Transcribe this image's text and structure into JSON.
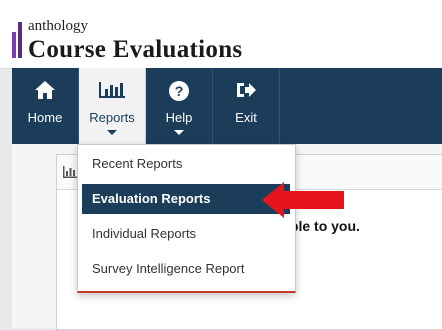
{
  "header": {
    "brand": "anthology",
    "product": "Course Evaluations"
  },
  "nav": {
    "items": [
      {
        "label": "Home",
        "icon": "home-icon"
      },
      {
        "label": "Reports",
        "icon": "bar-chart-icon",
        "active": true
      },
      {
        "label": "Help",
        "icon": "question-circle-icon"
      },
      {
        "label": "Exit",
        "icon": "sign-out-icon"
      }
    ]
  },
  "reports_menu": {
    "items": [
      {
        "label": "Recent Reports"
      },
      {
        "label": "Evaluation Reports",
        "selected": true
      },
      {
        "label": "Individual Reports"
      },
      {
        "label": "Survey Intelligence Report"
      }
    ]
  },
  "main": {
    "message_fragment": "available to you."
  },
  "colors": {
    "navbar": "#1c3d5a",
    "highlight": "#1c3d5a",
    "pointer_arrow": "#e8141c",
    "brand_mark": "#5b2a86"
  }
}
